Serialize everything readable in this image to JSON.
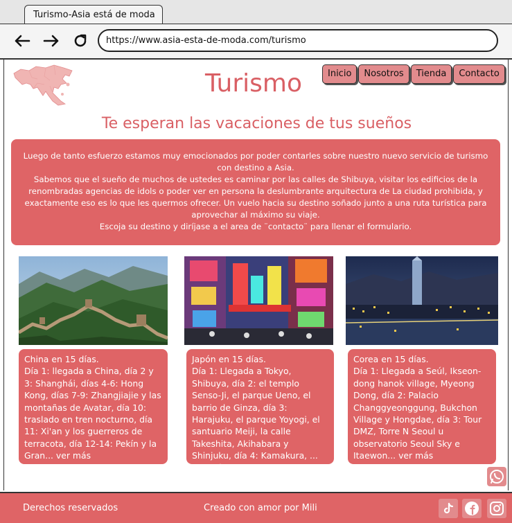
{
  "browser": {
    "tab_title": "Turismo-Asia está de moda",
    "url": "https://www.asia-esta-de-moda.com/turismo"
  },
  "header": {
    "title": "Turismo",
    "menu": [
      {
        "label": "Inicio"
      },
      {
        "label": "Nosotros"
      },
      {
        "label": "Tienda"
      },
      {
        "label": "Contacto"
      }
    ]
  },
  "main": {
    "subtitle": "Te esperan las vacaciones de tus sueños",
    "intro": [
      "Luego de tanto esfuerzo estamos muy emocionados por poder contarles sobre nuestro nuevo servicio de turismo con destino a Asia.",
      "Sabemos que el sueño de muchos de ustedes es caminar por las calles de Shibuya, visitar los edificios de la renombradas agencias de idols o poder ver en persona la deslumbrante arquitectura de La ciudad prohibida, y exactamente eso es lo que les quermos ofrecer. Un vuelo hacia su destino soñado junto a una ruta turística para aprovechar al máximo su viaje.",
      "Escoja su destino y diríjase a el area de ¨contacto¨ para llenar el formulario."
    ],
    "cards": [
      {
        "title": "China en 15 días.",
        "body": "Día 1: llegada a China, día 2 y 3: Shanghái, días 4-6: Hong Kong, días 7-9: Zhangjiajie y las montañas de Avatar, día 10: traslado en tren nocturno, día 11: Xi'an y los guerreros de terracota, día 12-14: Pekín y la Gran...",
        "more": "ver más"
      },
      {
        "title": "Japón en 15 días.",
        "body": "Día 1: Llegada a Tokyo, Shibuya, día 2: el templo Senso-Ji, el parque Ueno, el barrio de Ginza, día 3: Harajuku, el parque Yoyogi, el santuario Meiji, la calle Takeshita, Akihabara y Shinjuku, día 4: Kamakura, ...",
        "more": "ver más"
      },
      {
        "title": "Corea en 15 días.",
        "body": "Día 1:  Llegada a Seúl, Ikseon-dong hanok village, Myeong Dong, día 2: Palacio Changgyeonggung, Bukchon Village y Hongdae, día 3: Tour DMZ, Torre N Seoul u observatorio Seoul Sky e Itaewon...",
        "more": "ver más"
      }
    ]
  },
  "footer": {
    "rights": "Derechos reservados",
    "credit": "Creado con amor por Mili"
  },
  "colors": {
    "accent": "#df6466",
    "accent_light": "#e28b8d",
    "title": "#d95f64"
  },
  "icons": [
    "back-arrow-icon",
    "forward-arrow-icon",
    "reload-icon",
    "asia-map-icon",
    "whatsapp-icon",
    "tiktok-icon",
    "facebook-icon",
    "instagram-icon"
  ]
}
